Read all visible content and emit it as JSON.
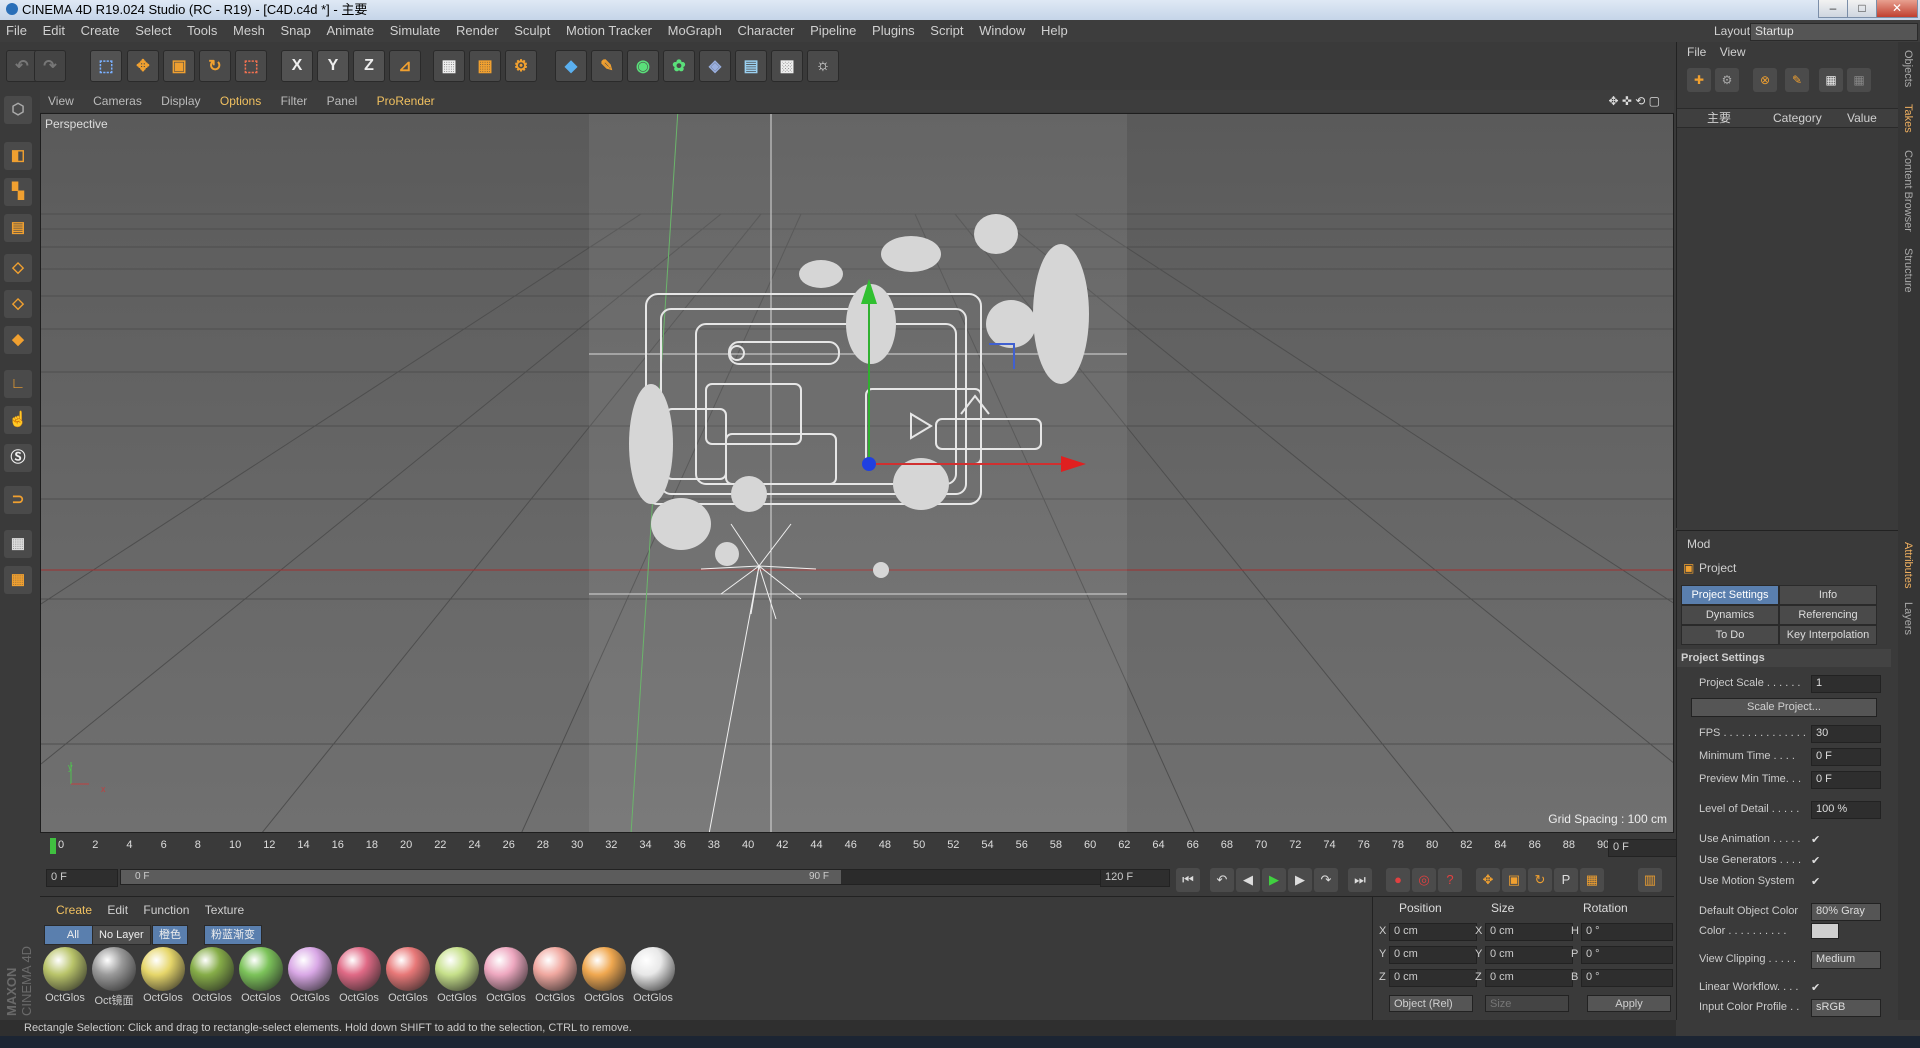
{
  "window": {
    "title": "CINEMA 4D R19.024 Studio (RC - R19) - [C4D.c4d *] - 主要"
  },
  "menu": [
    "File",
    "Edit",
    "Create",
    "Select",
    "Tools",
    "Mesh",
    "Snap",
    "Animate",
    "Simulate",
    "Render",
    "Sculpt",
    "Motion Tracker",
    "MoGraph",
    "Character",
    "Pipeline",
    "Plugins",
    "Script",
    "Window",
    "Help"
  ],
  "layout": {
    "label": "Layout:",
    "value": "Startup"
  },
  "toolbar": {
    "x": "X",
    "y": "Y",
    "z": "Z"
  },
  "viewport": {
    "menu": [
      "View",
      "Cameras",
      "Display",
      "Options",
      "Filter",
      "Panel",
      "ProRender"
    ],
    "name": "Perspective",
    "grid_spacing": "Grid Spacing : 100 cm",
    "axis_y": "y",
    "axis_x": "x"
  },
  "timeline": {
    "ticks": [
      "0",
      "2",
      "4",
      "6",
      "8",
      "10",
      "12",
      "14",
      "16",
      "18",
      "20",
      "22",
      "24",
      "26",
      "28",
      "30",
      "32",
      "34",
      "36",
      "38",
      "40",
      "42",
      "44",
      "46",
      "48",
      "50",
      "52",
      "54",
      "56",
      "58",
      "60",
      "62",
      "64",
      "66",
      "68",
      "70",
      "72",
      "74",
      "76",
      "78",
      "80",
      "82",
      "84",
      "86",
      "88",
      "90"
    ],
    "current_frame": "0 F"
  },
  "transport": {
    "start": "0 F",
    "range_start": "0 F",
    "range_end": "90 F",
    "end": "120 F"
  },
  "material_manager": {
    "menu": [
      "Create",
      "Edit",
      "Function",
      "Texture"
    ],
    "tabs": [
      "All",
      "No Layer",
      "橙色",
      "粉蓝渐变"
    ],
    "materials": [
      {
        "label": "OctGlos",
        "color": "#b9c46a"
      },
      {
        "label": "Oct镜面",
        "color": "#9a9a9a"
      },
      {
        "label": "OctGlos",
        "color": "#e6d66a"
      },
      {
        "label": "OctGlos",
        "color": "#86ad48"
      },
      {
        "label": "OctGlos",
        "color": "#7cc35a"
      },
      {
        "label": "OctGlos",
        "color": "#d9a8e6"
      },
      {
        "label": "OctGlos",
        "color": "#e06a86"
      },
      {
        "label": "OctGlos",
        "color": "#e87878"
      },
      {
        "label": "OctGlos",
        "color": "#c6e08a"
      },
      {
        "label": "OctGlos",
        "color": "#eea8c0"
      },
      {
        "label": "OctGlos",
        "color": "#f0a8a0"
      },
      {
        "label": "OctGlos",
        "color": "#f0a850"
      },
      {
        "label": "OctGlos",
        "color": "#e8e8e8"
      }
    ]
  },
  "coords": {
    "headers": [
      "Position",
      "Size",
      "Rotation"
    ],
    "rows": [
      {
        "a": "X",
        "p": "0 cm",
        "b": "X",
        "s": "0 cm",
        "c": "H",
        "r": "0 °"
      },
      {
        "a": "Y",
        "p": "0 cm",
        "b": "Y",
        "s": "0 cm",
        "c": "P",
        "r": "0 °"
      },
      {
        "a": "Z",
        "p": "0 cm",
        "b": "Z",
        "s": "0 cm",
        "c": "B",
        "r": "0 °"
      }
    ],
    "mode": "Object (Rel)",
    "size_mode": "Size",
    "apply": "Apply"
  },
  "status": "Rectangle Selection: Click and drag to rectangle-select elements. Hold down SHIFT to add to the selection, CTRL to remove.",
  "brand": {
    "maxon": "MAXON",
    "c4d": "CINEMA 4D"
  },
  "objects_panel": {
    "menu": [
      "File",
      "View"
    ],
    "root": "主要",
    "col_category": "Category",
    "col_value": "Value"
  },
  "right_tabs": [
    "Objects",
    "Takes",
    "Content Browser",
    "Structure"
  ],
  "right_tabs_bottom": [
    "Attributes",
    "Layers"
  ],
  "attributes": {
    "mode": "Mod",
    "object": "Project",
    "tabs": [
      "Project Settings",
      "Info",
      "Dynamics",
      "Referencing",
      "To Do",
      "Key Interpolation"
    ],
    "section": "Project Settings",
    "rows": [
      {
        "label": "Project Scale . . . . . .",
        "value": "1"
      },
      {
        "label": "FPS . . . . . . . . . . . . . .",
        "value": "30"
      },
      {
        "label": "Minimum Time . . . .",
        "value": "0 F"
      },
      {
        "label": "Preview Min Time. . .",
        "value": "0 F"
      },
      {
        "label": "Level of Detail . . . . .",
        "value": "100 %"
      }
    ],
    "scale_button": "Scale Project...",
    "checks": [
      "Use Animation . . . . .",
      "Use Generators . . . .",
      "Use Motion System"
    ],
    "default_color_label": "Default Object Color",
    "default_color_value": "80% Gray",
    "color_label": "Color . . . . . . . . . .",
    "view_clipping_label": "View Clipping . . . . .",
    "view_clipping_value": "Medium",
    "linear_workflow_label": "Linear Workflow. . . .",
    "input_color_label": "Input Color Profile . .",
    "input_color_value": "sRGB"
  }
}
